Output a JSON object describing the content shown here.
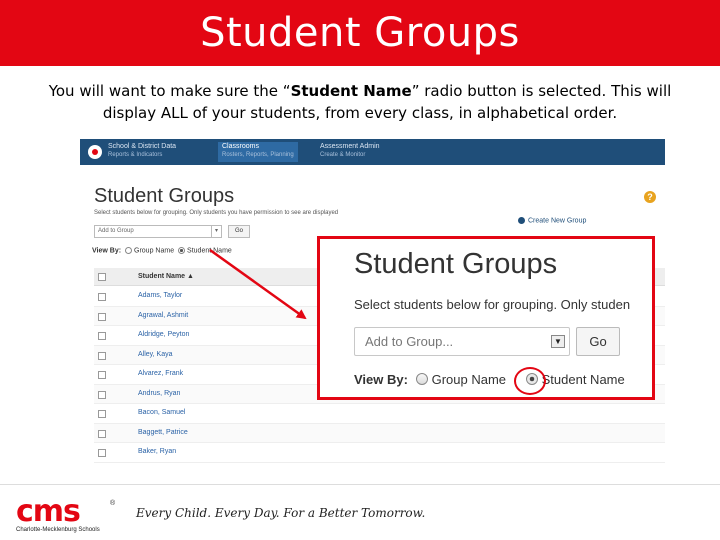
{
  "slide": {
    "title": "Student Groups",
    "intro_before": "You will want to make sure the “",
    "intro_bold": "Student Name",
    "intro_after": "” radio button is selected.  This will display ALL of your students, from every class, in alphabetical order."
  },
  "app": {
    "nav": [
      {
        "label": "School & District Data",
        "sub": "Reports & Indicators"
      },
      {
        "label": "Classrooms",
        "sub": "Rosters, Reports, Planning"
      },
      {
        "label": "Assessment Admin",
        "sub": "Create & Monitor"
      }
    ],
    "heading": "Student Groups",
    "instructions": "Select students below for grouping. Only students you have permission to see are displayed",
    "create_link": "Create New Group",
    "select_placeholder": "Add to Group",
    "go_label": "Go",
    "view_by_label": "View By:",
    "view_by_options": [
      "Group Name",
      "Student Name"
    ],
    "table_header": "Student Name ▲",
    "students": [
      "Adams, Taylor",
      "Agrawal, Ashmit",
      "Aldridge, Peyton",
      "Alley, Kaya",
      "Alvarez, Frank",
      "Andrus, Ryan",
      "Bacon, Samuel",
      "Baggett, Patrice",
      "Baker, Ryan"
    ]
  },
  "zoom": {
    "heading": "Student Groups",
    "instructions": "Select students below for grouping. Only studen",
    "select_placeholder": "Add to Group...",
    "go_label": "Go",
    "view_by_label": "View By:",
    "option_group": "Group Name",
    "option_student": "Student Name"
  },
  "footer": {
    "logo_text": "cms",
    "logo_reg": "®",
    "logo_sub": "Charlotte-Mecklenburg Schools",
    "tagline": "Every Child. Every Day. For a Better Tomorrow."
  },
  "colors": {
    "accent": "#e30613",
    "nav": "#1f4e79",
    "link": "#2a62a6"
  },
  "icons": [
    "help-icon",
    "plus-icon",
    "dropdown-arrow-icon",
    "sort-asc-icon"
  ]
}
